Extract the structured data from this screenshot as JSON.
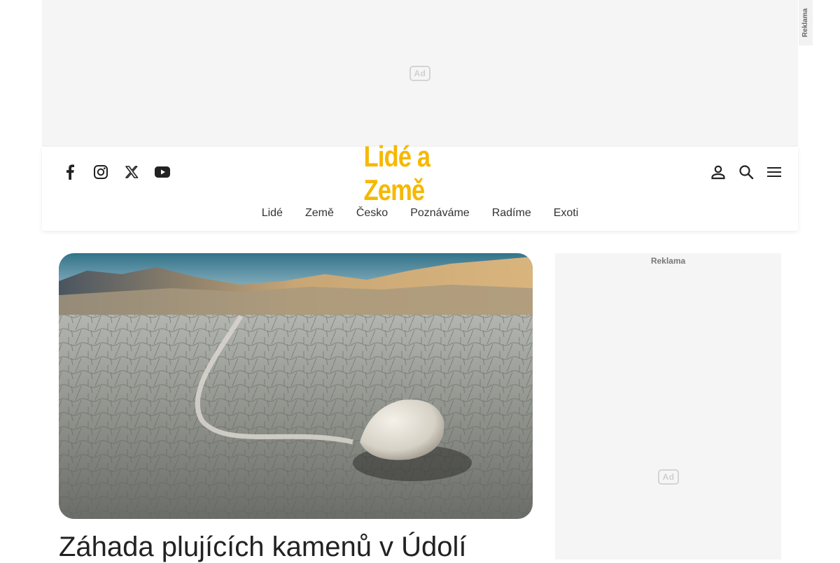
{
  "ads": {
    "top_glyph": "Ad",
    "side_vertical_label": "Reklama",
    "sidebar_label": "Reklama",
    "sidebar_glyph": "Ad"
  },
  "header": {
    "logo": "Lidé a Země",
    "social_icons": [
      "facebook-icon",
      "instagram-icon",
      "x-twitter-icon",
      "youtube-icon"
    ],
    "right_icons": [
      "user-icon",
      "search-icon",
      "menu-icon"
    ],
    "accent_color": "#f6b800"
  },
  "nav": {
    "items": [
      {
        "label": "Lidé"
      },
      {
        "label": "Země"
      },
      {
        "label": "Česko"
      },
      {
        "label": "Poznáváme"
      },
      {
        "label": "Radíme"
      },
      {
        "label": "Exoti"
      }
    ]
  },
  "article": {
    "headline": "Záhada plujících kamenů v Údolí"
  }
}
